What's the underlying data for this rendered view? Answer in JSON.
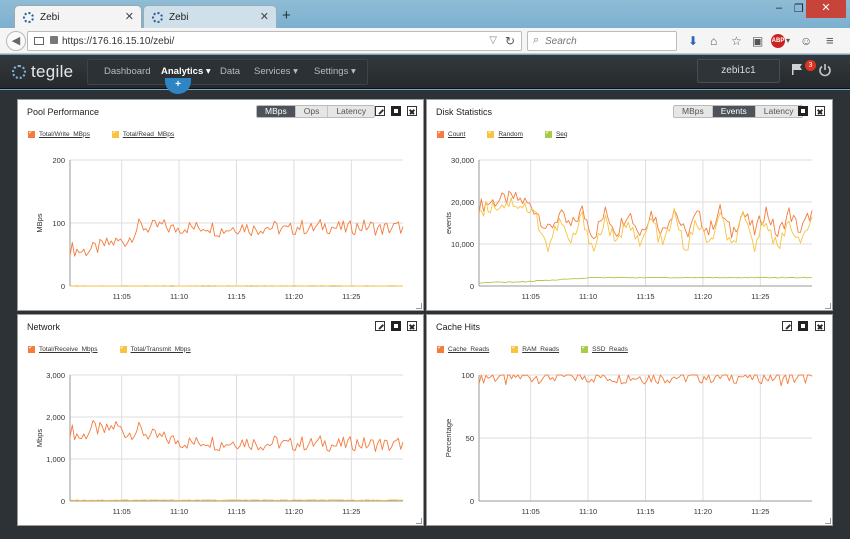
{
  "browser": {
    "tabs": [
      {
        "title": "Zebi",
        "active": true
      },
      {
        "title": "Zebi",
        "active": false
      }
    ],
    "url": "https://176.16.15.10/zebi/",
    "search_placeholder": "Search",
    "abp_label": "ABP"
  },
  "app": {
    "logo_text": "tegile",
    "nav": [
      {
        "label": "Dashboard",
        "active": false
      },
      {
        "label": "Analytics",
        "active": true,
        "caret": "▾"
      },
      {
        "label": "Data",
        "active": false
      },
      {
        "label": "Services",
        "active": false,
        "caret": "▾"
      },
      {
        "label": "Settings",
        "active": false,
        "caret": "▾"
      }
    ],
    "add_label": "+",
    "user": "zebi1c1",
    "alert_count": "3"
  },
  "panels": {
    "pool": {
      "title": "Pool Performance",
      "toggles": [
        "MBps",
        "Ops",
        "Latency"
      ],
      "selected": "MBps",
      "legend": [
        {
          "label": "Total/Write_MBps",
          "color": "#f47c3c"
        },
        {
          "label": "Total/Read_MBps",
          "color": "#f6c343"
        }
      ]
    },
    "disk": {
      "title": "Disk Statistics",
      "toggles": [
        "MBps",
        "Events",
        "Latency"
      ],
      "selected": "Events",
      "legend": [
        {
          "label": "Count",
          "color": "#f47c3c"
        },
        {
          "label": "Random",
          "color": "#f6c343"
        },
        {
          "label": "Seq",
          "color": "#a8cc4a"
        }
      ]
    },
    "network": {
      "title": "Network",
      "legend": [
        {
          "label": "Total/Receive_Mbps",
          "color": "#f47c3c"
        },
        {
          "label": "Total/Transmit_Mbps",
          "color": "#f6c343"
        }
      ]
    },
    "cache": {
      "title": "Cache Hits",
      "legend": [
        {
          "label": "Cache_Reads",
          "color": "#f47c3c"
        },
        {
          "label": "RAM_Reads",
          "color": "#f6c343"
        },
        {
          "label": "SSD_Reads",
          "color": "#a8cc4a"
        }
      ]
    }
  },
  "chart_data": [
    {
      "type": "line",
      "title": "",
      "xlabel": "",
      "ylabel": "MBps",
      "ylim": [
        0,
        200
      ],
      "yticks": [
        "0",
        "100",
        "200"
      ],
      "xlim": [
        "11:00:30",
        "11:29:30"
      ],
      "xticks": [
        "11:05",
        "11:10",
        "11:15",
        "11:20",
        "11:25"
      ],
      "grid": true,
      "series": [
        {
          "name": "Total/Write_MBps",
          "color": "#f47c3c",
          "x": [
            "11:00:30",
            "11:01:30",
            "11:02:30",
            "11:03:30",
            "11:04:30",
            "11:05:30",
            "11:06:30",
            "11:07:30",
            "11:08:30",
            "11:09:30",
            "11:10:30",
            "11:11:30",
            "11:12:30",
            "11:13:30",
            "11:14:30",
            "11:15:30",
            "11:16:30",
            "11:17:30",
            "11:18:30",
            "11:19:30",
            "11:20:30",
            "11:21:30",
            "11:22:30",
            "11:23:30",
            "11:24:30",
            "11:25:30",
            "11:26:30",
            "11:27:30",
            "11:28:30",
            "11:29:30"
          ],
          "values": [
            60,
            55,
            58,
            65,
            70,
            72,
            95,
            92,
            96,
            90,
            94,
            92,
            96,
            88,
            92,
            95,
            90,
            94,
            92,
            88,
            95,
            90,
            96,
            93,
            91,
            94,
            95,
            90,
            92,
            94
          ]
        },
        {
          "name": "Total/Read_MBps",
          "color": "#f6c343",
          "x": [
            "11:00:30",
            "11:29:30"
          ],
          "values": [
            0,
            0
          ]
        }
      ]
    },
    {
      "type": "line",
      "title": "",
      "xlabel": "",
      "ylabel": "events",
      "ylim": [
        0,
        30000
      ],
      "yticks": [
        "0",
        "10,000",
        "20,000",
        "30,000"
      ],
      "xlim": [
        "11:00:30",
        "11:29:30"
      ],
      "xticks": [
        "11:05",
        "11:10",
        "11:15",
        "11:20",
        "11:25"
      ],
      "grid": true,
      "series": [
        {
          "name": "Count",
          "color": "#f47c3c",
          "x": [
            "11:00:30",
            "11:01:30",
            "11:02:30",
            "11:03:30",
            "11:04:30",
            "11:05:30",
            "11:06:30",
            "11:07:30",
            "11:08:30",
            "11:09:30",
            "11:10:30",
            "11:11:30",
            "11:12:30",
            "11:13:30",
            "11:14:30",
            "11:15:30",
            "11:16:30",
            "11:17:30",
            "11:18:30",
            "11:19:30",
            "11:20:30",
            "11:21:30",
            "11:22:30",
            "11:23:30",
            "11:24:30",
            "11:25:30",
            "11:26:30",
            "11:27:30",
            "11:28:30",
            "11:29:30"
          ],
          "values": [
            19000,
            20000,
            20500,
            21000,
            20000,
            18000,
            13000,
            17000,
            14000,
            18000,
            12000,
            17500,
            13000,
            18000,
            12500,
            17500,
            13000,
            18500,
            12000,
            17000,
            13000,
            18000,
            12500,
            17500,
            13000,
            18000,
            12000,
            17500,
            13000,
            18000
          ]
        },
        {
          "name": "Random",
          "color": "#f6c343",
          "x": [
            "11:00:30",
            "11:01:30",
            "11:02:30",
            "11:03:30",
            "11:04:30",
            "11:05:30",
            "11:06:30",
            "11:07:30",
            "11:08:30",
            "11:09:30",
            "11:10:30",
            "11:11:30",
            "11:12:30",
            "11:13:30",
            "11:14:30",
            "11:15:30",
            "11:16:30",
            "11:17:30",
            "11:18:30",
            "11:19:30",
            "11:20:30",
            "11:21:30",
            "11:22:30",
            "11:23:30",
            "11:24:30",
            "11:25:30",
            "11:26:30",
            "11:27:30",
            "11:28:30",
            "11:29:30"
          ],
          "values": [
            18000,
            19000,
            19500,
            20000,
            19000,
            16500,
            9000,
            15500,
            10000,
            16500,
            8500,
            16000,
            9500,
            16500,
            9000,
            16000,
            9500,
            17000,
            8500,
            15500,
            9500,
            16500,
            9000,
            16000,
            9500,
            16500,
            8500,
            16000,
            9500,
            16500
          ]
        },
        {
          "name": "Seq",
          "color": "#a8cc4a",
          "x": [
            "11:00:30",
            "11:04:30",
            "11:05:30",
            "11:10:30",
            "11:15:30",
            "11:20:30",
            "11:25:30",
            "11:29:30"
          ],
          "values": [
            800,
            1000,
            1200,
            2000,
            2000,
            2000,
            2000,
            2000
          ]
        }
      ]
    },
    {
      "type": "line",
      "title": "",
      "xlabel": "",
      "ylabel": "Mbps",
      "ylim": [
        0,
        3000
      ],
      "yticks": [
        "0",
        "1,000",
        "2,000",
        "3,000"
      ],
      "xlim": [
        "11:00:30",
        "11:29:30"
      ],
      "xticks": [
        "11:05",
        "11:10",
        "11:15",
        "11:20",
        "11:25"
      ],
      "grid": true,
      "series": [
        {
          "name": "Total/Receive_Mbps",
          "color": "#f47c3c",
          "x": [
            "11:00:30",
            "11:01:30",
            "11:02:30",
            "11:03:30",
            "11:04:30",
            "11:05:30",
            "11:06:30",
            "11:07:30",
            "11:08:30",
            "11:09:30",
            "11:10:30",
            "11:11:30",
            "11:12:30",
            "11:13:30",
            "11:14:30",
            "11:15:30",
            "11:16:30",
            "11:17:30",
            "11:18:30",
            "11:19:30",
            "11:20:30",
            "11:21:30",
            "11:22:30",
            "11:23:30",
            "11:24:30",
            "11:25:30",
            "11:26:30",
            "11:27:30",
            "11:28:30",
            "11:29:30"
          ],
          "values": [
            1700,
            1500,
            1750,
            1650,
            1800,
            1600,
            1700,
            1550,
            1500,
            1450,
            1400,
            1380,
            1450,
            1350,
            1400,
            1420,
            1380,
            1350,
            1400,
            1330,
            1380,
            1350,
            1400,
            1320,
            1350,
            1380,
            1340,
            1360,
            1300,
            1400
          ]
        },
        {
          "name": "Total/Transmit_Mbps",
          "color": "#f6c343",
          "x": [
            "11:00:30",
            "11:29:30"
          ],
          "values": [
            20,
            20
          ]
        }
      ]
    },
    {
      "type": "line",
      "title": "",
      "xlabel": "",
      "ylabel": "Percentage",
      "ylim": [
        0,
        100
      ],
      "yticks": [
        "0",
        "50",
        "100"
      ],
      "xlim": [
        "11:00:30",
        "11:29:30"
      ],
      "xticks": [
        "11:05",
        "11:10",
        "11:15",
        "11:20",
        "11:25"
      ],
      "grid": true,
      "series": [
        {
          "name": "Cache_Reads",
          "color": "#f47c3c",
          "x": [
            "11:00:30",
            "11:02:30",
            "11:03:00",
            "11:03:30",
            "11:05:30",
            "11:10:30",
            "11:15:30",
            "11:20:30",
            "11:25:30",
            "11:27:00",
            "11:29:30"
          ],
          "values": [
            99,
            99,
            95,
            99,
            99,
            99,
            98.5,
            99,
            99,
            97,
            99
          ]
        },
        {
          "name": "RAM_Reads",
          "color": "#f6c343",
          "x": [],
          "values": []
        },
        {
          "name": "SSD_Reads",
          "color": "#a8cc4a",
          "x": [],
          "values": []
        }
      ]
    }
  ]
}
